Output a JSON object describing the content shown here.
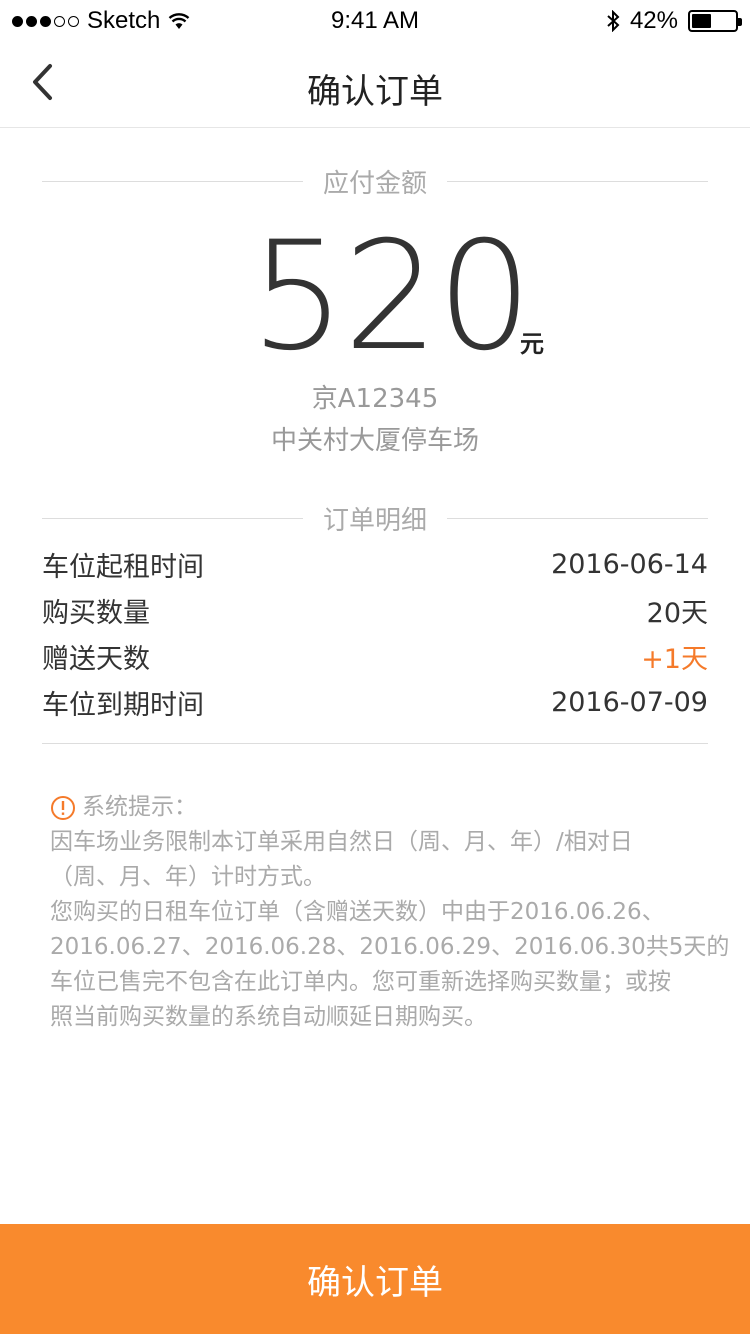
{
  "status_bar": {
    "carrier": "Sketch",
    "time": "9:41 AM",
    "battery_percent": "42%",
    "battery_level": 0.42,
    "signal_bars_filled": 3,
    "signal_bars_total": 5
  },
  "nav": {
    "title": "确认订单",
    "back_icon": "chevron-left-icon"
  },
  "payment": {
    "section_label": "应付金额",
    "amount": "520",
    "unit": "元",
    "plate": "京A12345",
    "lot_name": "中关村大厦停车场"
  },
  "details": {
    "section_label": "订单明细",
    "rows": [
      {
        "label": "车位起租时间",
        "value": "2016-06-14"
      },
      {
        "label": "购买数量",
        "value": "20天"
      },
      {
        "label": "赠送天数",
        "value": "+1天"
      },
      {
        "label": "车位到期时间",
        "value": "2016-07-09"
      }
    ]
  },
  "notice": {
    "icon": "warning-circle-icon",
    "title": "系统提示：",
    "lines": [
      "因车场业务限制本订单采用自然日（周、月、年）/相对日",
      "（周、月、年）计时方式。",
      "您购买的日租车位订单（含赠送天数）中由于2016.06.26、",
      "2016.06.27、2016.06.28、2016.06.29、2016.06.30共5天的",
      "车位已售完不包含在此订单内。您可重新选择购买数量；或按",
      "照当前购买数量的系统自动顺延日期购买。"
    ]
  },
  "confirm_button": {
    "label": "确认订单"
  },
  "colors": {
    "accent": "#f98a2d",
    "highlight": "#f57a2a",
    "muted_text": "#999999",
    "divider": "#dddddd"
  }
}
